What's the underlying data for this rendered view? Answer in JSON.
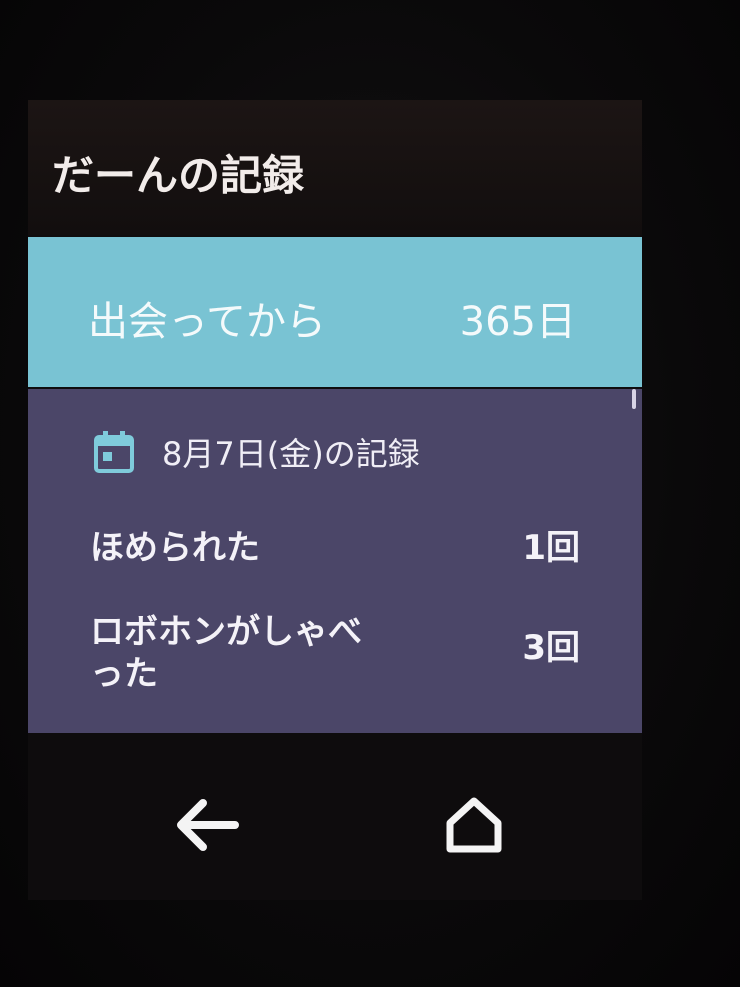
{
  "app": {
    "title": "だーんの記録"
  },
  "summary": {
    "label": "出会ってから",
    "value": "365日"
  },
  "record": {
    "date_heading": "8月7日(金)の記録",
    "icon": "calendar-icon",
    "items": [
      {
        "label": "ほめられた",
        "count": "1回"
      },
      {
        "label": "ロボホンがしゃべった",
        "count": "3回"
      }
    ]
  },
  "navigation": {
    "back_icon": "back-arrow-icon",
    "home_icon": "home-icon"
  },
  "colors": {
    "accent_card": "#79c3d3",
    "panel": "#4b4668",
    "text": "#f4f2f8",
    "background": "#0f0d0e"
  }
}
